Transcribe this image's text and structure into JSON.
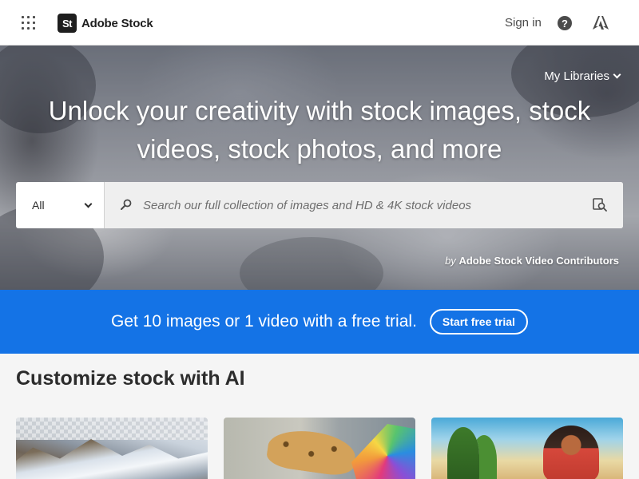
{
  "header": {
    "logo_badge": "St",
    "logo_text": "Adobe Stock",
    "sign_in": "Sign in",
    "help_glyph": "?",
    "icons": [
      "apps-grid-icon",
      "help-icon",
      "adobe-icon"
    ]
  },
  "hero": {
    "my_libraries": "My Libraries",
    "title_line1": "Unlock your creativity with stock images, stock",
    "title_line2": "videos, stock photos, and more",
    "search": {
      "category": "All",
      "placeholder": "Search our full collection of images and HD & 4K stock videos",
      "value": ""
    },
    "credit_by": "by",
    "credit_name": "Adobe Stock Video Contributors"
  },
  "trial_banner": {
    "text": "Get 10 images or 1 video with a free trial.",
    "button": "Start free trial",
    "color": "#1473e6"
  },
  "section": {
    "title": "Customize stock with AI"
  }
}
